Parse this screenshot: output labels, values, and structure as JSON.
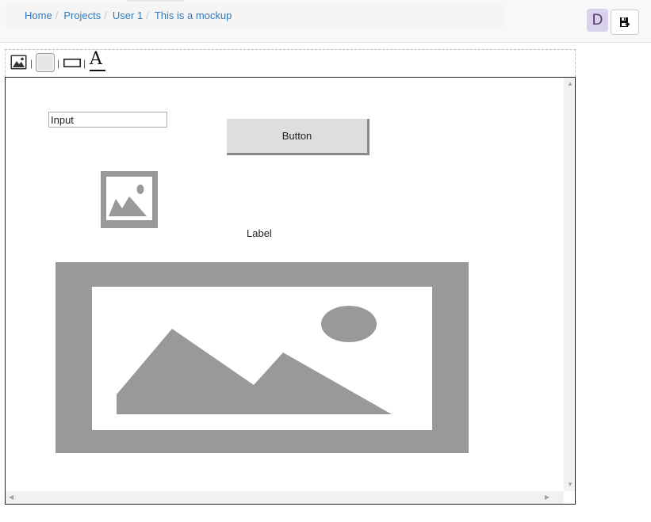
{
  "breadcrumb": {
    "items": [
      {
        "label": "Home"
      },
      {
        "label": "Projects"
      },
      {
        "label": "User 1"
      },
      {
        "label": "This is a mockup"
      }
    ],
    "separator": "/"
  },
  "user": {
    "initial": "D"
  },
  "header": {
    "save_icon": "save-export-icon"
  },
  "toolbar": {
    "tools": [
      {
        "name": "image-tool-icon"
      },
      {
        "name": "button-tool-icon"
      },
      {
        "name": "input-tool-icon"
      },
      {
        "name": "label-tool-icon",
        "glyph": "A"
      }
    ],
    "separator": "|"
  },
  "canvas": {
    "input": {
      "value": "Input"
    },
    "button": {
      "label": "Button"
    },
    "label": {
      "text": "Label"
    },
    "images": [
      "image-placeholder-small",
      "image-placeholder-large"
    ]
  },
  "colors": {
    "link": "#337ab7",
    "avatar_bg": "#d8d2ec",
    "placeholder_gray": "#999999",
    "button_bg": "#dedede"
  }
}
